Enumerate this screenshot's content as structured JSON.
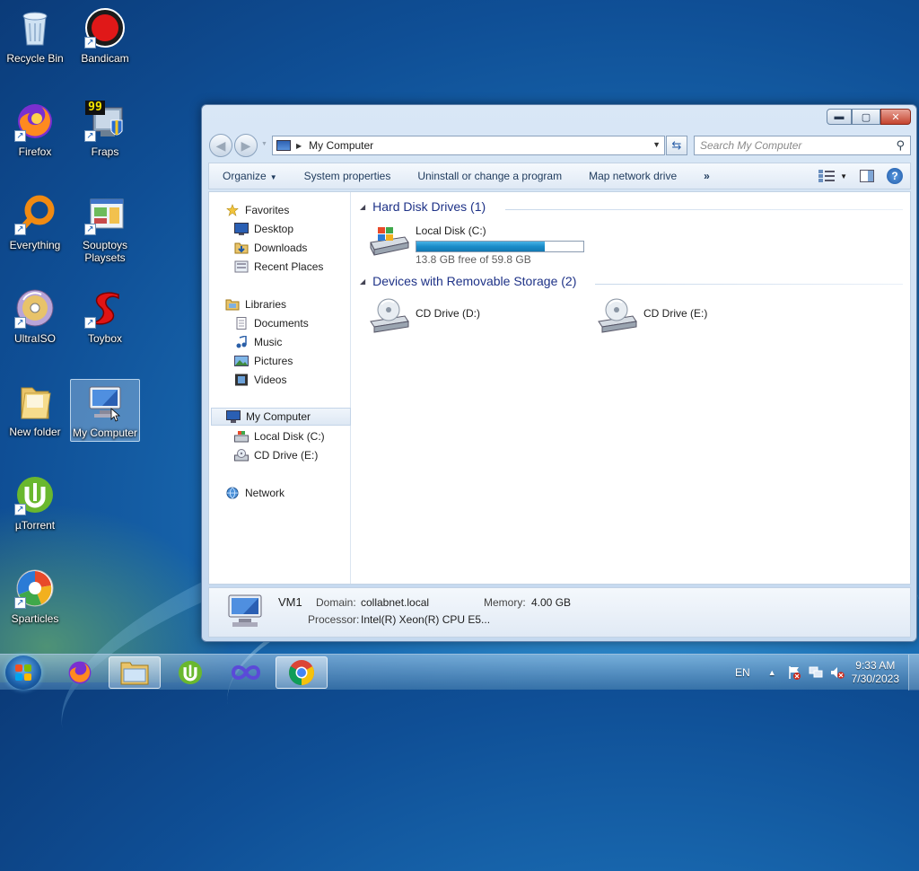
{
  "desktop": {
    "icons": [
      {
        "label": "Recycle Bin",
        "icon": "recycle-bin-icon"
      },
      {
        "label": "Bandicam",
        "icon": "bandicam-icon"
      },
      {
        "label": "Firefox",
        "icon": "firefox-icon"
      },
      {
        "label": "Fraps",
        "icon": "fraps-icon"
      },
      {
        "label": "Everything",
        "icon": "everything-icon"
      },
      {
        "label": "Souptoys Playsets",
        "icon": "souptoys-icon"
      },
      {
        "label": "UltraISO",
        "icon": "ultraiso-icon"
      },
      {
        "label": "Toybox",
        "icon": "toybox-icon"
      },
      {
        "label": "New folder",
        "icon": "folder-icon"
      },
      {
        "label": "My Computer",
        "icon": "computer-icon"
      },
      {
        "label": "µTorrent",
        "icon": "utorrent-icon"
      },
      {
        "label": "Sparticles",
        "icon": "sparticles-icon"
      }
    ],
    "fraps_badge": "99"
  },
  "window": {
    "address": "My Computer",
    "search_placeholder": "Search My Computer",
    "toolbar": {
      "organize": "Organize",
      "system_properties": "System properties",
      "uninstall": "Uninstall or change a program",
      "map_drive": "Map network drive",
      "more": "»"
    },
    "nav": {
      "favorites": "Favorites",
      "desktop": "Desktop",
      "downloads": "Downloads",
      "recent": "Recent Places",
      "libraries": "Libraries",
      "documents": "Documents",
      "music": "Music",
      "pictures": "Pictures",
      "videos": "Videos",
      "computer": "My Computer",
      "local_disk": "Local Disk (C:)",
      "cd_drive": "CD Drive (E:)",
      "network": "Network"
    },
    "groups": {
      "hdd": "Hard Disk Drives (1)",
      "removable": "Devices with Removable Storage (2)"
    },
    "drives": {
      "c": {
        "label": "Local Disk (C:)",
        "free": "13.8 GB free of 59.8 GB",
        "used_fraction": 0.77
      },
      "d": {
        "label": "CD Drive (D:)"
      },
      "e": {
        "label": "CD Drive (E:)"
      }
    },
    "details": {
      "name": "VM1",
      "domain_label": "Domain:",
      "domain": "collabnet.local",
      "memory_label": "Memory:",
      "memory": "4.00 GB",
      "processor_label": "Processor:",
      "processor": "Intel(R) Xeon(R) CPU E5..."
    }
  },
  "taskbar": {
    "lang": "EN",
    "time": "9:33 AM",
    "date": "7/30/2023"
  },
  "colors": {
    "accent": "#1a8cc9",
    "close": "#c4432e",
    "group_header": "#1e3287"
  }
}
